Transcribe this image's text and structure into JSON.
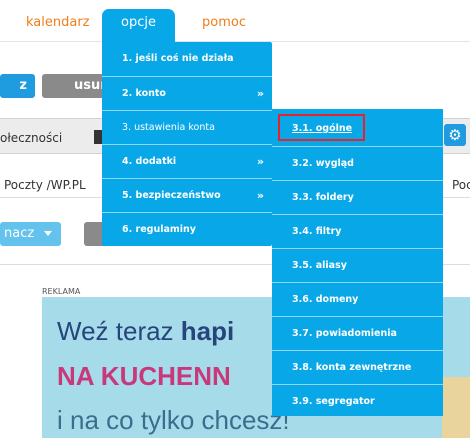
{
  "nav": {
    "items": [
      {
        "label": "kalendarz"
      },
      {
        "label": "opcje"
      },
      {
        "label": "pomoc"
      }
    ]
  },
  "toolbar": {
    "left_button": "z",
    "usun_button": "usuń",
    "oznacz_button": "nacz"
  },
  "tabs": {
    "partial_label": "ołeczności"
  },
  "path": {
    "left": "Poczty /WP.PL",
    "right": "Poc"
  },
  "menu": {
    "items": [
      {
        "label": "1. jeśli coś nie działa",
        "arrow": ""
      },
      {
        "label": "2. konto",
        "arrow": "»"
      },
      {
        "label": "3. ustawienia konta",
        "arrow": "»"
      },
      {
        "label": "4. dodatki",
        "arrow": "»"
      },
      {
        "label": "5. bezpieczeństwo",
        "arrow": "»"
      },
      {
        "label": "6. regulaminy",
        "arrow": ""
      }
    ]
  },
  "submenu": {
    "items": [
      {
        "label": "3.1. ogólne"
      },
      {
        "label": "3.2. wygląd"
      },
      {
        "label": "3.3. foldery"
      },
      {
        "label": "3.4. filtry"
      },
      {
        "label": "3.5. aliasy"
      },
      {
        "label": "3.6. domeny"
      },
      {
        "label": "3.7. powiadomienia"
      },
      {
        "label": "3.8. konta zewnętrzne"
      },
      {
        "label": "3.9. segregator"
      }
    ],
    "highlighted": "3.1. ogólne"
  },
  "ad": {
    "label": "REKLAMA",
    "line1_prefix": "Weź teraz ",
    "line1_bold": "hapi",
    "line2": "NA KUCHENN",
    "line3": "i na co tylko chcesz!"
  },
  "colors": {
    "accent": "#08a8e8",
    "nav_text": "#f07d1c",
    "highlight_border": "#e8222d",
    "ad_background": "#a6dcea",
    "ad_pink": "#c8387b"
  },
  "icons": {
    "gear": "gear-icon",
    "submenu_arrow": "chevron-right-icon"
  }
}
